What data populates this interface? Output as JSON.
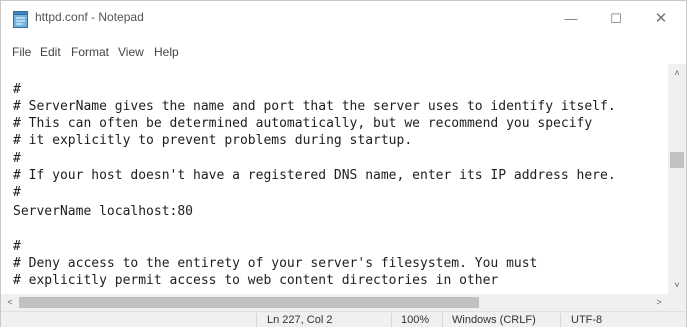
{
  "window": {
    "title": "httpd.conf - Notepad",
    "controls": {
      "minimize": "—",
      "maximize": "☐",
      "close": "✕"
    }
  },
  "menu": {
    "items": [
      "File",
      "Edit",
      "Format",
      "View",
      "Help"
    ]
  },
  "editor": {
    "lines": [
      "#",
      "# ServerName gives the name and port that the server uses to identify itself.",
      "# This can often be determined automatically, but we recommend you specify",
      "# it explicitly to prevent problems during startup.",
      "#",
      "# If your host doesn't have a registered DNS name, enter its IP address here.",
      "#",
      "ServerName localhost:80",
      "",
      "#",
      "# Deny access to the entirety of your server's filesystem. You must",
      "# explicitly permit access to web content directories in other"
    ]
  },
  "scrollbars": {
    "up_arrow": "˄",
    "down_arrow": "˅",
    "left_arrow": "<",
    "right_arrow": ">"
  },
  "status": {
    "position": "Ln 227, Col 2",
    "zoom": "100%",
    "line_ending": "Windows (CRLF)",
    "encoding": "UTF-8"
  },
  "icons": {
    "app": "notepad-icon"
  },
  "colors": {
    "background": "#ffffff",
    "chrome": "#f0f0f0",
    "scroll_thumb": "#c1c1c1",
    "text": "#1e1e1e"
  }
}
